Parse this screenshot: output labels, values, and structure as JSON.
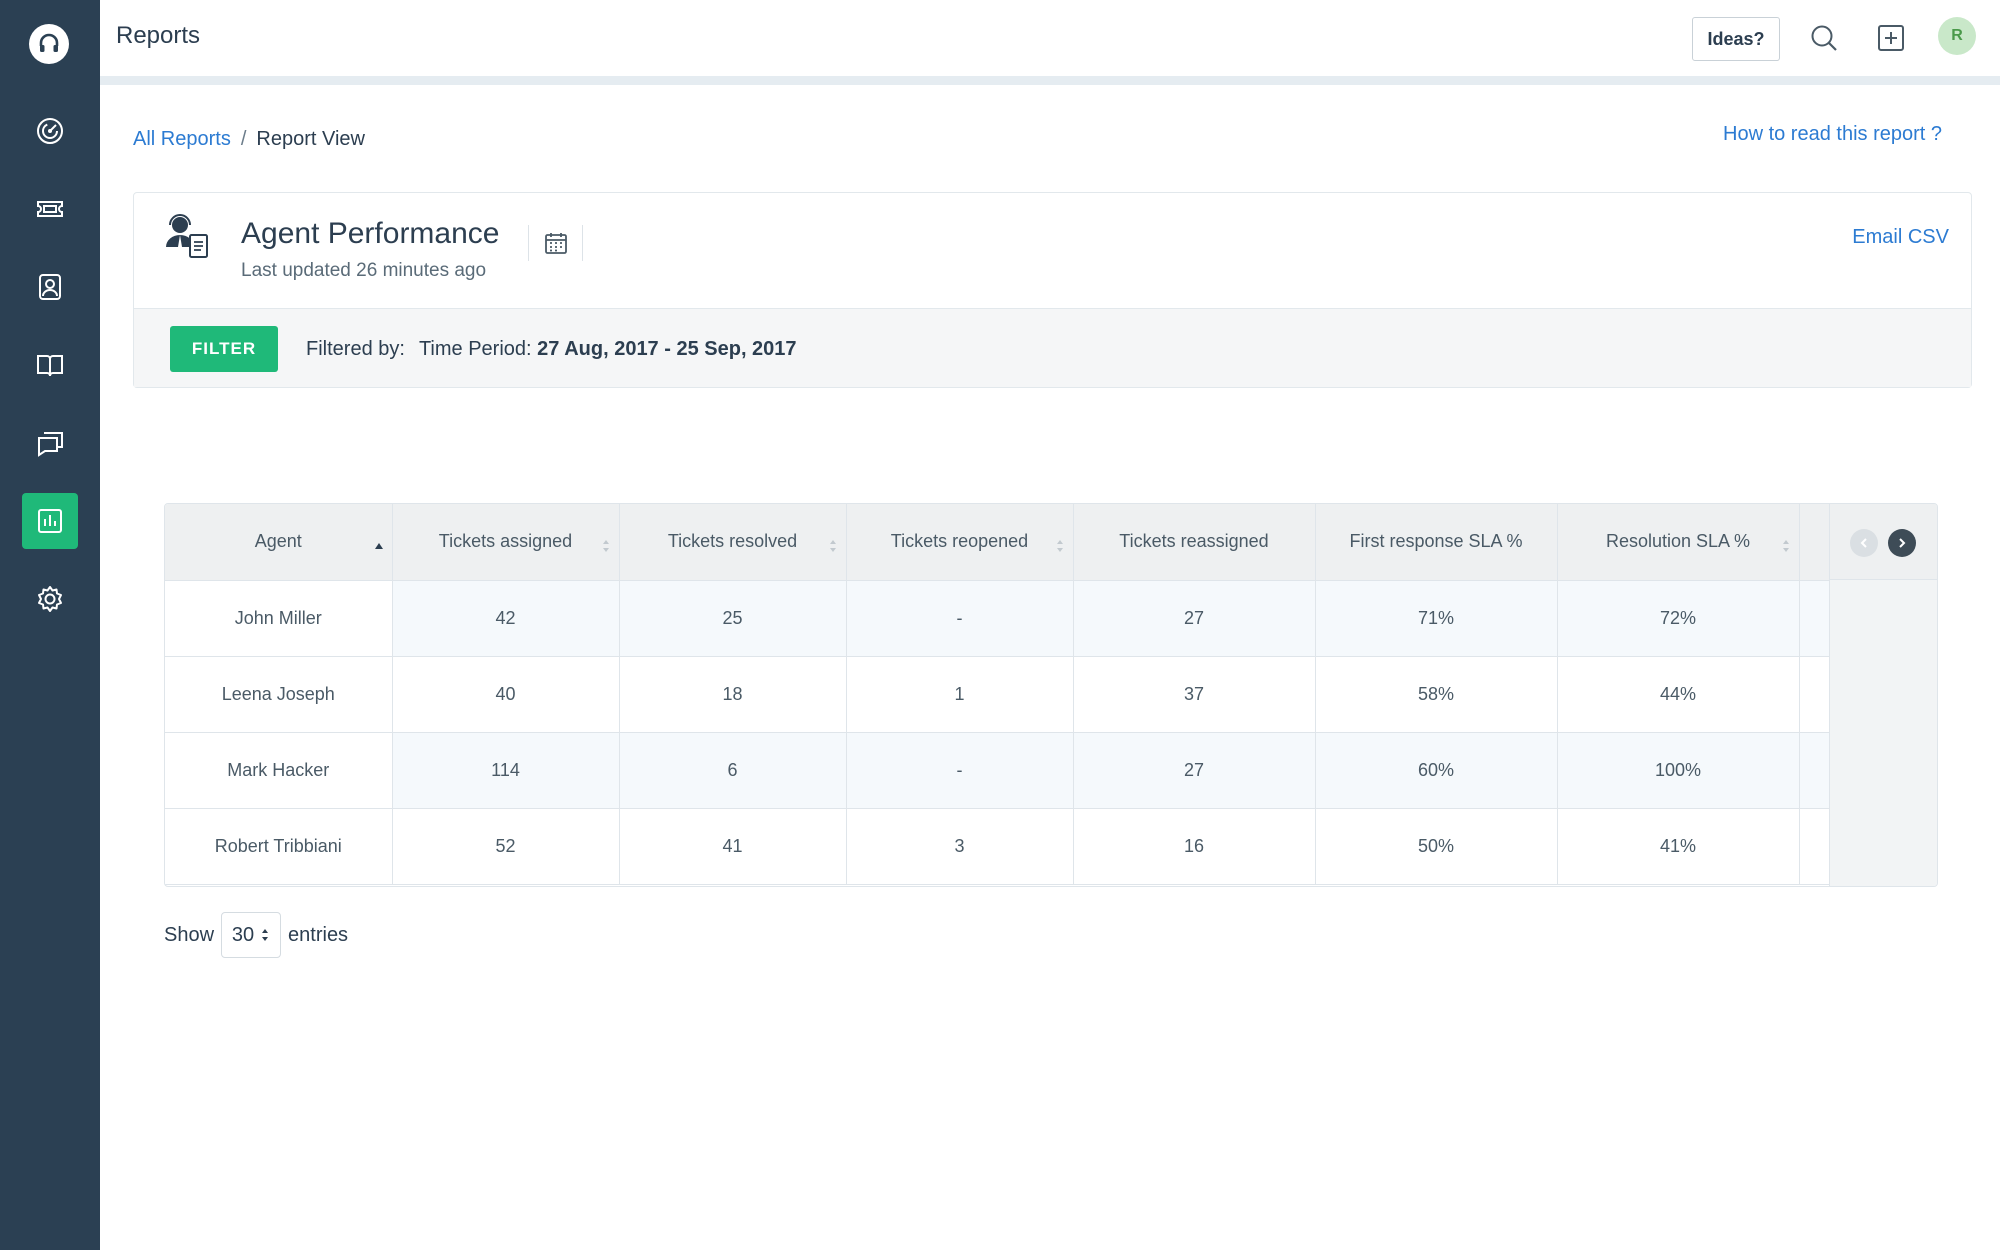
{
  "header": {
    "title": "Reports",
    "ideas_label": "Ideas?",
    "avatar_initial": "R"
  },
  "sidebar": {
    "items": [
      {
        "name": "dashboard",
        "icon": "dashboard-icon",
        "active": false
      },
      {
        "name": "tickets",
        "icon": "ticket-icon",
        "active": false
      },
      {
        "name": "contacts",
        "icon": "contact-icon",
        "active": false
      },
      {
        "name": "solutions",
        "icon": "book-icon",
        "active": false
      },
      {
        "name": "forums",
        "icon": "chat-icon",
        "active": false
      },
      {
        "name": "reports",
        "icon": "reports-icon",
        "active": true
      },
      {
        "name": "admin",
        "icon": "gear-icon",
        "active": false
      }
    ]
  },
  "breadcrumb": {
    "all_reports": "All Reports",
    "separator": "/",
    "current": "Report View"
  },
  "help_link": "How to read this report ?",
  "report": {
    "title": "Agent Performance",
    "updated": "Last updated 26 minutes ago",
    "email_csv": "Email CSV",
    "filter_button": "FILTER",
    "filtered_by": "Filtered by:",
    "time_period_label": "Time Period:",
    "time_period_value": "27 Aug, 2017 - 25 Sep, 2017"
  },
  "table": {
    "columns": [
      "Agent",
      "Tickets assigned",
      "Tickets resolved",
      "Tickets reopened",
      "Tickets reassigned",
      "First response SLA %",
      "Resolution SLA %"
    ],
    "rows": [
      [
        "John Miller",
        "42",
        "25",
        "-",
        "27",
        "71%",
        "72%"
      ],
      [
        "Leena Joseph",
        "40",
        "18",
        "1",
        "37",
        "58%",
        "44%"
      ],
      [
        "Mark Hacker",
        "114",
        "6",
        "-",
        "27",
        "60%",
        "100%"
      ],
      [
        "Robert Tribbiani",
        "52",
        "41",
        "3",
        "16",
        "50%",
        "41%"
      ]
    ]
  },
  "pagination": {
    "show_label": "Show",
    "entries_value": "30",
    "entries_label": "entries"
  },
  "colors": {
    "sidebar_bg": "#2b4053",
    "accent_green": "#1fb979",
    "link_blue": "#2c7bd2"
  }
}
